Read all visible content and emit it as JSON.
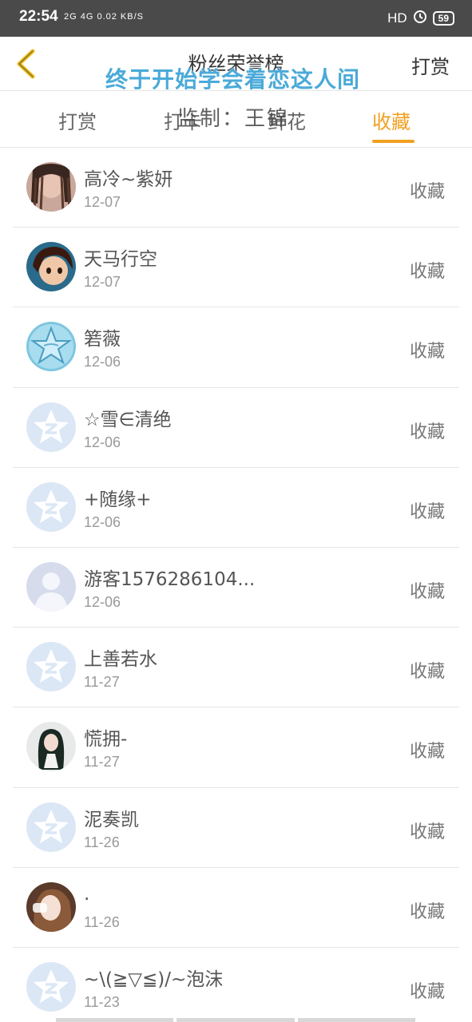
{
  "status_bar": {
    "time": "22:54",
    "signal": "2G 4G 0.02 KB/S",
    "hd": "HD",
    "battery": "59"
  },
  "header": {
    "title": "粉丝荣誉榜",
    "action": "打赏"
  },
  "overlay": {
    "caption": "终于开始学会着恋这人间",
    "credit": "监制：王锦"
  },
  "tabs": [
    {
      "label": "打赏",
      "active": false
    },
    {
      "label": "打卡",
      "active": false
    },
    {
      "label": "鲜花",
      "active": false
    },
    {
      "label": "收藏",
      "active": true
    }
  ],
  "colors": {
    "accent": "#f0a020",
    "watermark": "#4aaad8"
  },
  "rows": [
    {
      "name": "高冷~紫妍",
      "date": "12-07",
      "action": "收藏",
      "avatar": "photo-girl-braids"
    },
    {
      "name": "天马行空",
      "date": "12-07",
      "action": "收藏",
      "avatar": "anime-boy"
    },
    {
      "name": "箬薇",
      "date": "12-06",
      "action": "收藏",
      "avatar": "blue-star-photo"
    },
    {
      "name": "☆雪∈清绝",
      "date": "12-06",
      "action": "收藏",
      "avatar": "default-qzone-star"
    },
    {
      "name": "+随缘+",
      "date": "12-06",
      "action": "收藏",
      "avatar": "default-qzone-star"
    },
    {
      "name": "游客1576286104...",
      "date": "12-06",
      "action": "收藏",
      "avatar": "default-person"
    },
    {
      "name": "上善若水",
      "date": "11-27",
      "action": "收藏",
      "avatar": "default-qzone-star"
    },
    {
      "name": "慌拥-",
      "date": "11-27",
      "action": "收藏",
      "avatar": "photo-girl-dark-hair"
    },
    {
      "name": "泥奏凯",
      "date": "11-26",
      "action": "收藏",
      "avatar": "default-qzone-star"
    },
    {
      "name": ".",
      "date": "11-26",
      "action": "收藏",
      "avatar": "photo-girl-brown-hair"
    },
    {
      "name": "~\\(≧▽≦)/~泡沫",
      "date": "11-23",
      "action": "收藏",
      "avatar": "default-qzone-star"
    }
  ]
}
